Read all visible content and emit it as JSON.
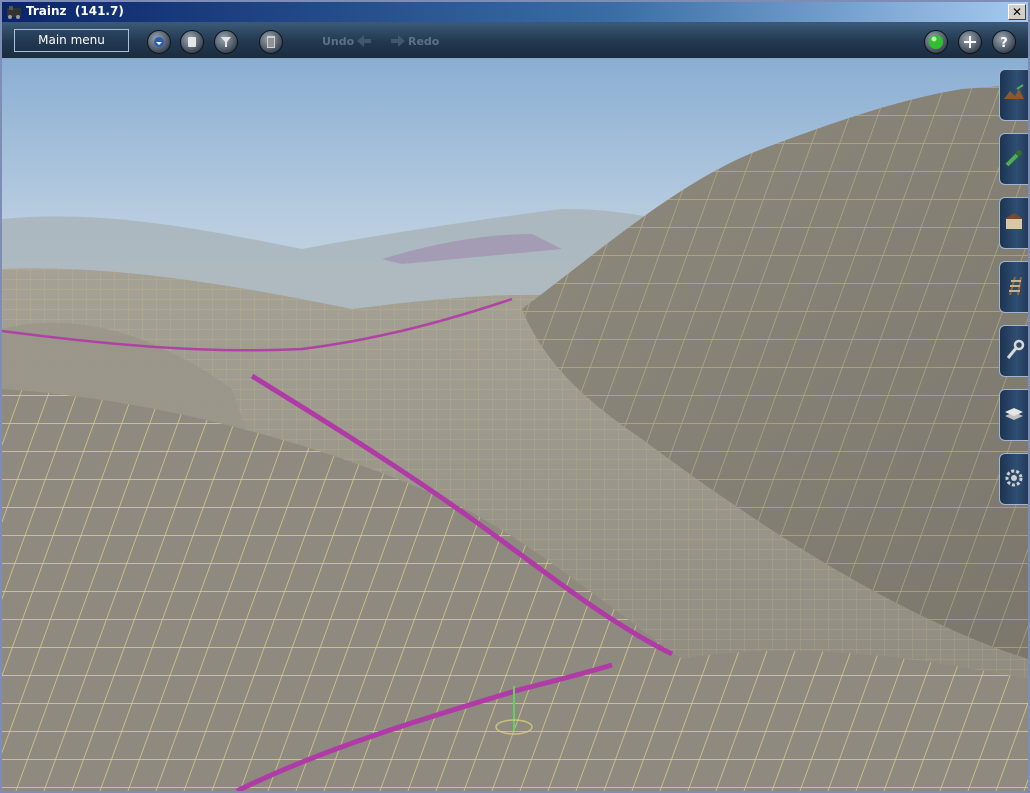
{
  "window": {
    "title": "Trainz  (141.7)",
    "close_glyph": "✕"
  },
  "toolbar": {
    "main_menu_label": "Main menu",
    "buttons": [
      {
        "icon": "compass-icon"
      },
      {
        "icon": "delete-icon"
      },
      {
        "icon": "filter-icon"
      },
      {
        "icon": "bin-icon"
      }
    ],
    "undo_label": "Undo",
    "redo_label": "Redo",
    "right_buttons": [
      {
        "icon": "status-light-icon",
        "color": "#2fbf2f"
      },
      {
        "icon": "plus-icon"
      },
      {
        "icon": "help-icon"
      }
    ]
  },
  "side_tabs": [
    {
      "name": "topology-tab",
      "icon": "terrain-icon"
    },
    {
      "name": "paint-tab",
      "icon": "brush-icon"
    },
    {
      "name": "objects-tab",
      "icon": "building-icon"
    },
    {
      "name": "track-tab",
      "icon": "track-icon"
    },
    {
      "name": "tools-tab",
      "icon": "wrench-icon"
    },
    {
      "name": "layers-tab",
      "icon": "layers-icon"
    },
    {
      "name": "settings-tab",
      "icon": "gear-icon"
    }
  ],
  "colors": {
    "accent": "#2fbf2f",
    "grid": "#f3e08a",
    "track": "#b03aa6",
    "sky": "#9cb8d6"
  }
}
